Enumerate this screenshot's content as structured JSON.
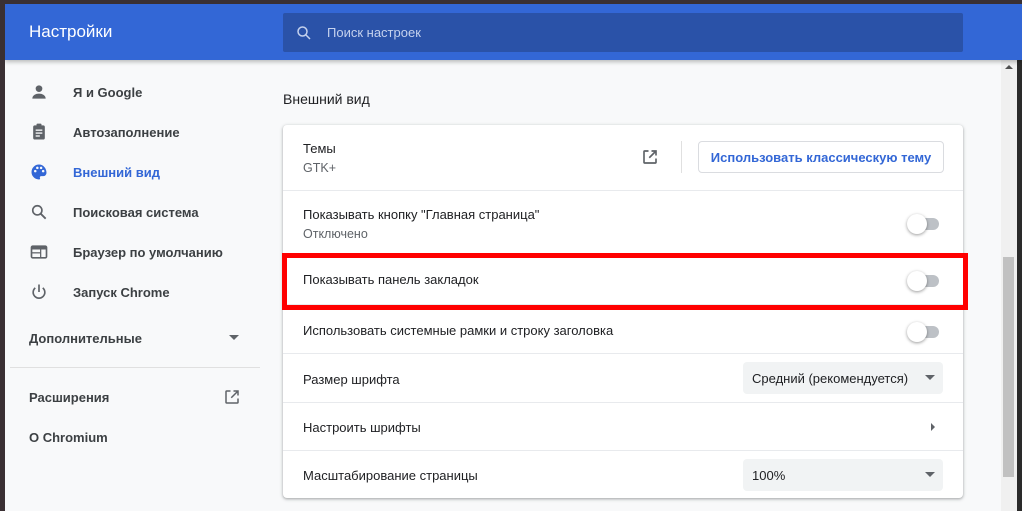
{
  "header": {
    "title": "Настройки",
    "search_placeholder": "Поиск настроек"
  },
  "sidebar": {
    "items": [
      {
        "label": "Я и Google",
        "icon": "person-icon",
        "active": false
      },
      {
        "label": "Автозаполнение",
        "icon": "clipboard-icon",
        "active": false
      },
      {
        "label": "Внешний вид",
        "icon": "palette-icon",
        "active": true
      },
      {
        "label": "Поисковая система",
        "icon": "search-icon",
        "active": false
      },
      {
        "label": "Браузер по умолчанию",
        "icon": "browser-window-icon",
        "active": false
      },
      {
        "label": "Запуск Chrome",
        "icon": "power-icon",
        "active": false
      }
    ],
    "advanced_label": "Дополнительные",
    "extensions_label": "Расширения",
    "about_label": "О Chromium"
  },
  "main": {
    "section_title": "Внешний вид",
    "themes": {
      "label": "Темы",
      "value": "GTK+",
      "button_label": "Использовать классическую тему"
    },
    "home_button": {
      "label": "Показывать кнопку \"Главная страница\"",
      "value": "Отключено",
      "enabled": false
    },
    "bookmarks_bar": {
      "label": "Показывать панель закладок",
      "enabled": false,
      "highlighted": true
    },
    "system_frame": {
      "label": "Использовать системные рамки и строку заголовка",
      "enabled": false
    },
    "font_size": {
      "label": "Размер шрифта",
      "selected": "Средний (рекомендуется)"
    },
    "customize_fonts": {
      "label": "Настроить шрифты"
    },
    "page_zoom": {
      "label": "Масштабирование страницы",
      "selected": "100%"
    }
  },
  "colors": {
    "accent": "#3367d6",
    "search_bg": "#2a52a8",
    "highlight": "#ff0000"
  }
}
